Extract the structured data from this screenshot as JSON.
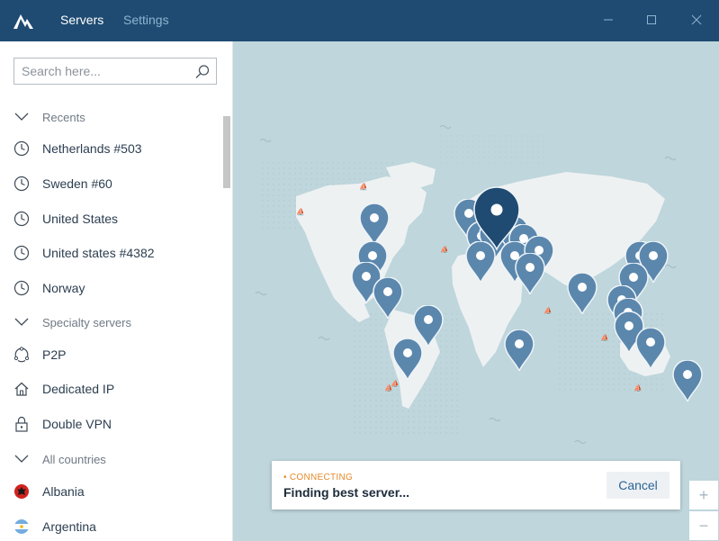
{
  "titlebar": {
    "tabs": [
      {
        "label": "Servers",
        "active": true
      },
      {
        "label": "Settings",
        "active": false
      }
    ],
    "bg_color": "#1f4b72"
  },
  "sidebar": {
    "search": {
      "placeholder": "Search here..."
    },
    "rows": [
      {
        "type": "section",
        "label": "Recents",
        "icon": "chevron-down-icon"
      },
      {
        "type": "item",
        "label": "Netherlands #503",
        "icon": "clock-icon"
      },
      {
        "type": "item",
        "label": "Sweden #60",
        "icon": "clock-icon"
      },
      {
        "type": "item",
        "label": "United States",
        "icon": "clock-icon"
      },
      {
        "type": "item",
        "label": "United states #4382",
        "icon": "clock-icon"
      },
      {
        "type": "item",
        "label": "Norway",
        "icon": "clock-icon"
      },
      {
        "type": "section",
        "label": "Specialty servers",
        "icon": "chevron-down-icon"
      },
      {
        "type": "item",
        "label": "P2P",
        "icon": "p2p-icon"
      },
      {
        "type": "item",
        "label": "Dedicated IP",
        "icon": "home-icon"
      },
      {
        "type": "item",
        "label": "Double VPN",
        "icon": "lock-icon"
      },
      {
        "type": "section",
        "label": "All countries",
        "icon": "chevron-down-icon"
      },
      {
        "type": "item",
        "label": "Albania",
        "icon": "albania-flag-icon"
      },
      {
        "type": "item",
        "label": "Argentina",
        "icon": "argentina-flag-icon"
      }
    ]
  },
  "status": {
    "state": "CONNECTING",
    "message": "Finding best server...",
    "cancel_label": "Cancel",
    "accent_color": "#e58a2c"
  },
  "zoom": {
    "in_label": "+",
    "out_label": "−"
  },
  "map": {
    "ocean_color": "#bed6dc",
    "land_color": "#eef1f2",
    "pin_color": "#5b87ad",
    "active_pin_color": "#1f4b72"
  }
}
